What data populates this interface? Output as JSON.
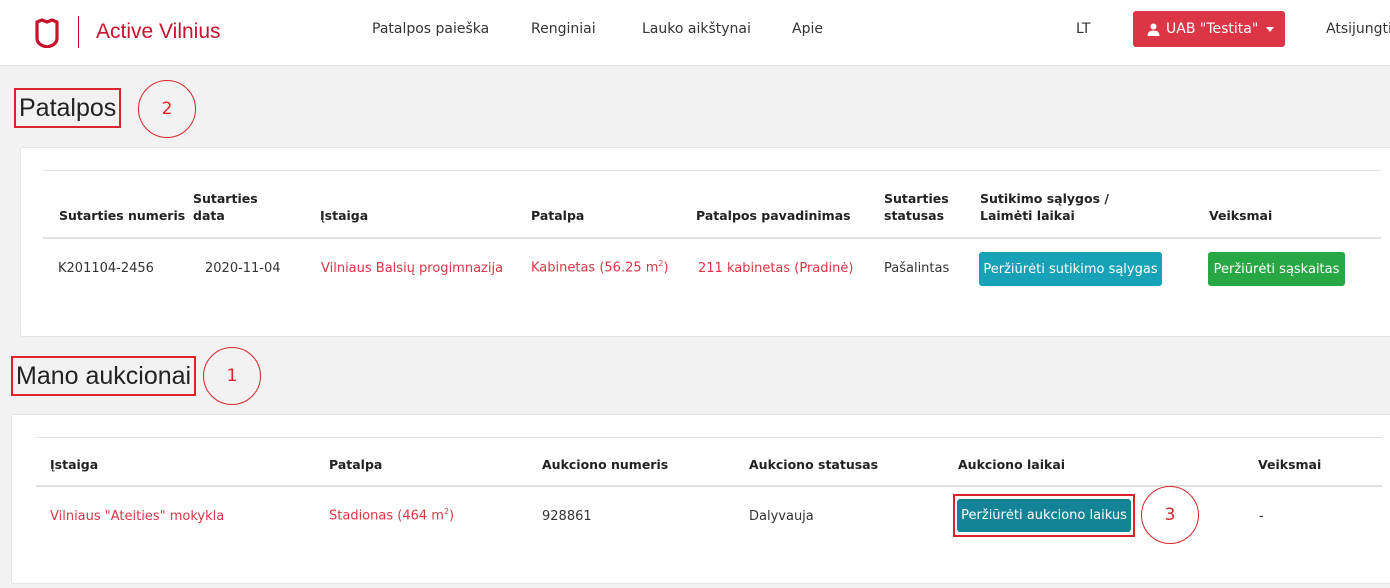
{
  "header": {
    "brand": "Active Vilnius",
    "nav": [
      "Patalpos paieška",
      "Renginiai",
      "Lauko aikštynai",
      "Apie"
    ],
    "language": "LT",
    "user_label": "UAB \"Testita\"",
    "logout": "Atsijungti"
  },
  "patalpos": {
    "title": "Patalpos",
    "annotation": "2",
    "columns": {
      "c1": "Sutarties numeris",
      "c2": "Sutarties data",
      "c3": "Įstaiga",
      "c4": "Patalpa",
      "c5": "Patalpos pavadinimas",
      "c6": "Sutarties statusas",
      "c7": "Sutikimo sąlygos / Laimėti laikai",
      "c8": "Veiksmai"
    },
    "row": {
      "number": "K201104-2456",
      "date": "2020-11-04",
      "institution": "Vilniaus Balsių progimnazija",
      "room": "Kabinetas (56.25 m",
      "room_sup": "2",
      "room_close": ")",
      "room_name": "211 kabinetas (Pradinė)",
      "status": "Pašalintas",
      "terms_button": "Peržiūrėti sutikimo sąlygas",
      "invoices_button": "Peržiūrėti sąskaitas"
    }
  },
  "aukcionai": {
    "title": "Mano aukcionai",
    "annotation": "1",
    "columns": {
      "c1": "Įstaiga",
      "c2": "Patalpa",
      "c3": "Aukciono numeris",
      "c4": "Aukciono statusas",
      "c5": "Aukciono laikai",
      "c6": "Veiksmai"
    },
    "row": {
      "institution": "Vilniaus \"Ateities\" mokykla",
      "room": "Stadionas (464 m",
      "room_sup": "2",
      "room_close": ")",
      "number": "928861",
      "status": "Dalyvauja",
      "times_button": "Peržiūrėti aukciono laikus",
      "actions": "-"
    },
    "button_annotation": "3"
  },
  "colors": {
    "brand_red": "#c8102e",
    "danger": "#dc3545",
    "info": "#17a2b8",
    "success": "#28a745",
    "teal": "#138496",
    "annotation_red": "#d9252a"
  }
}
